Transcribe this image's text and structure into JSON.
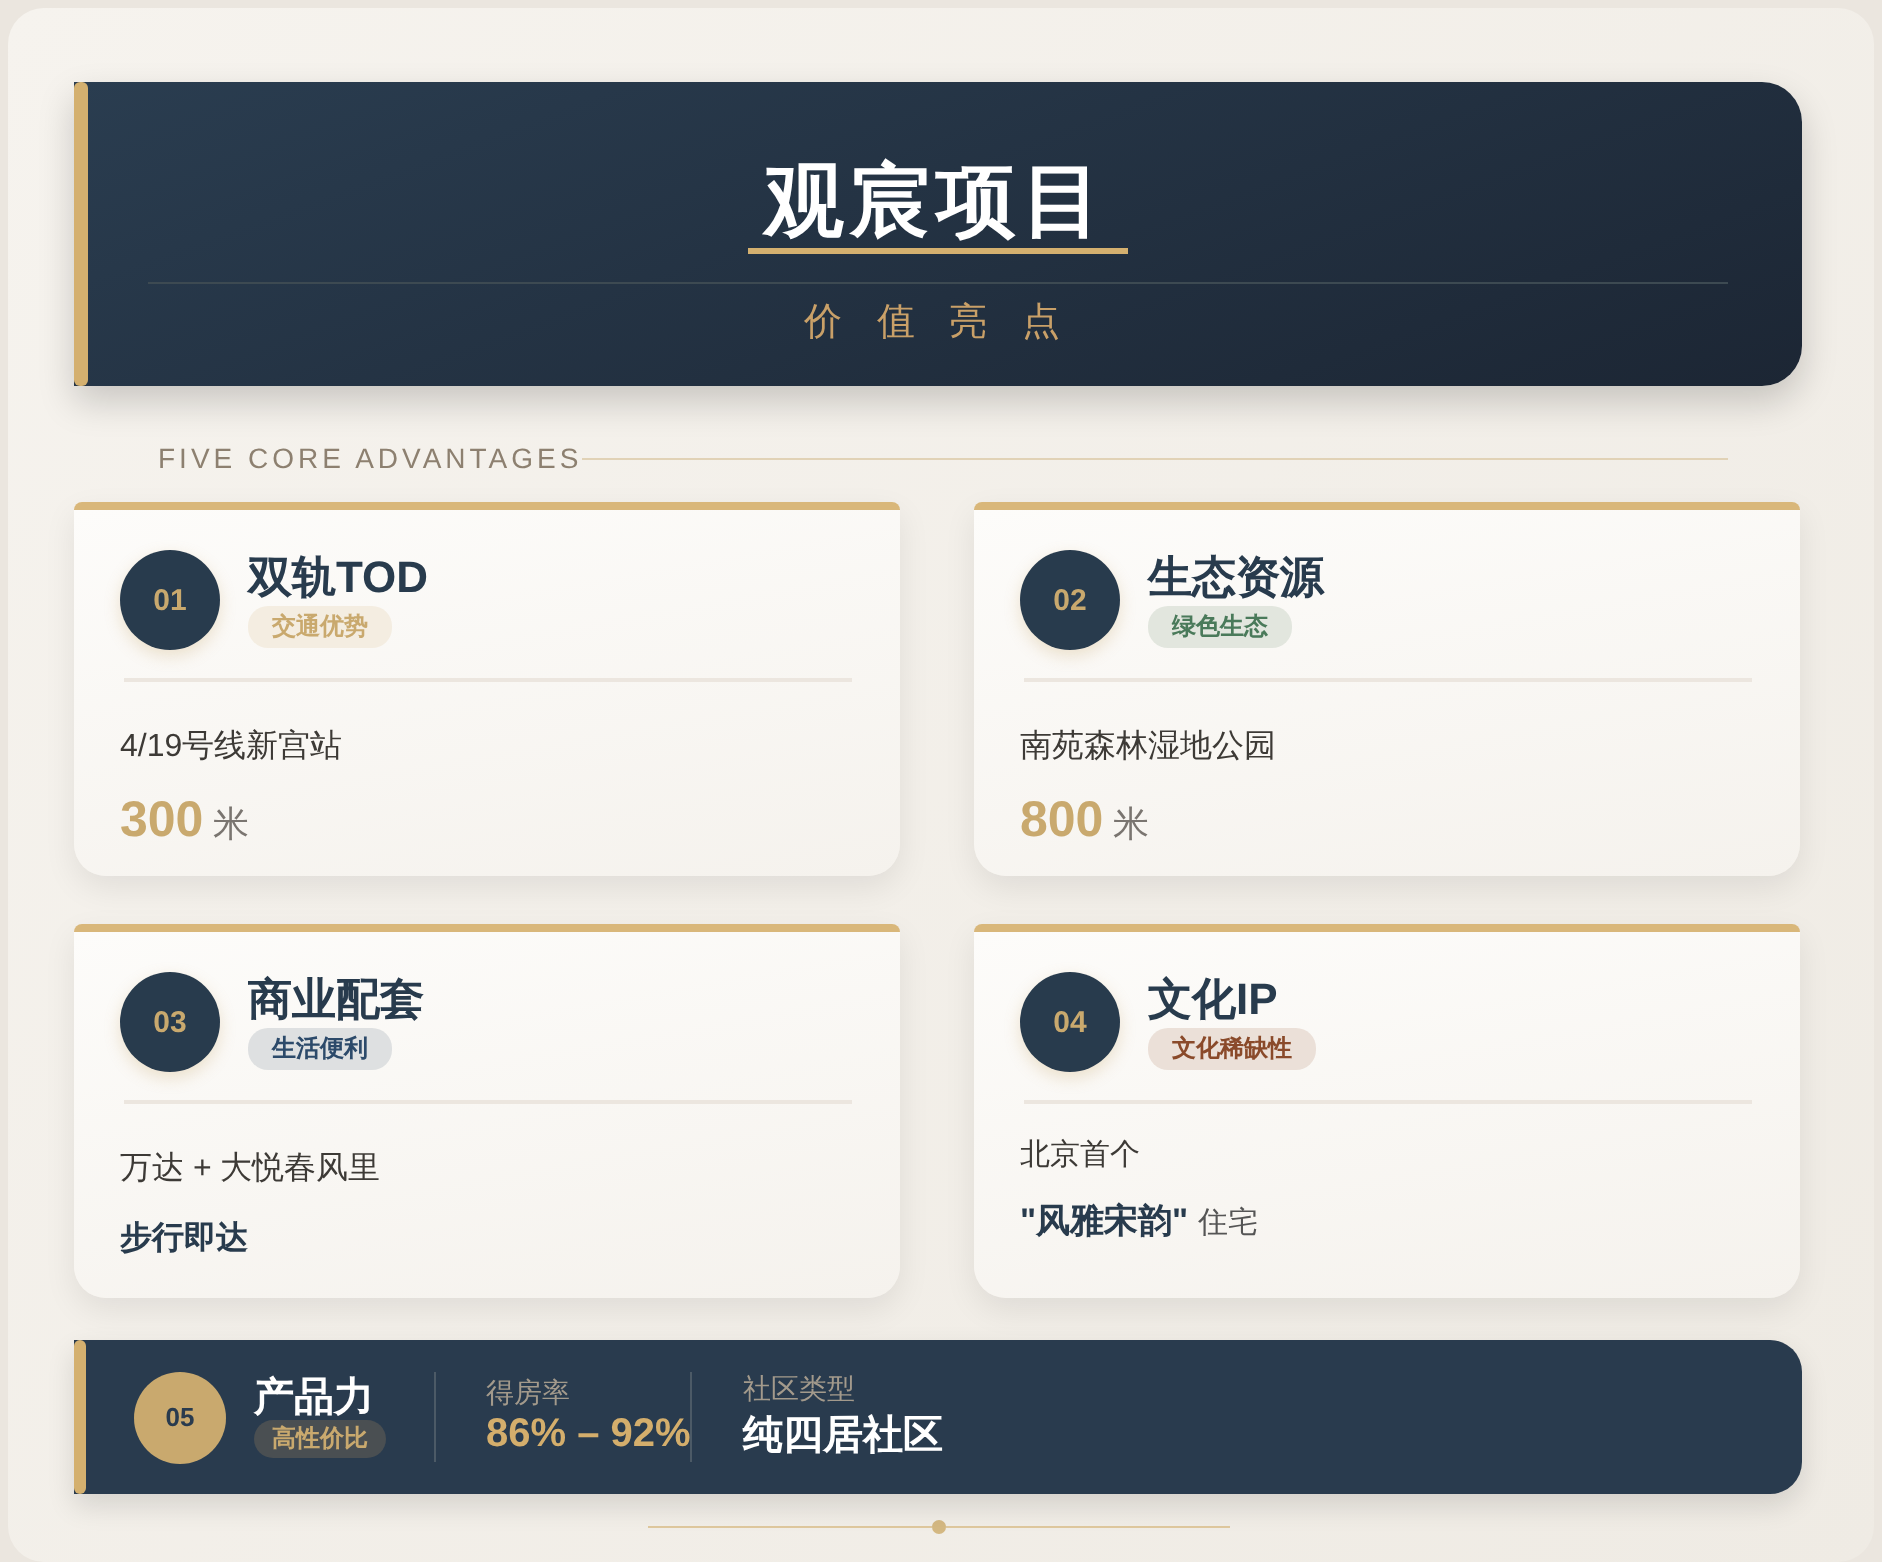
{
  "header": {
    "title": "观宸项目",
    "subtitle": "价 值 亮 点"
  },
  "section_label": "FIVE CORE ADVANTAGES",
  "cards": [
    {
      "number": "01",
      "title": "双轨TOD",
      "tag": {
        "label": "交通优势",
        "color": "#c9a96e"
      },
      "kind": "distance",
      "line": "4/19号线新宫站",
      "value": "300",
      "unit": "米"
    },
    {
      "number": "02",
      "title": "生态资源",
      "tag": {
        "label": "绿色生态",
        "color": "#4a7a5a"
      },
      "kind": "distance",
      "line": "南苑森林湿地公园",
      "value": "800",
      "unit": "米"
    },
    {
      "number": "03",
      "title": "商业配套",
      "tag": {
        "label": "生活便利",
        "color": "#2c4a6a"
      },
      "kind": "note",
      "line": "万达 + 大悦春风里",
      "note": "步行即达"
    },
    {
      "number": "04",
      "title": "文化IP",
      "tag": {
        "label": "文化稀缺性",
        "color": "#8a4a2a"
      },
      "kind": "quote",
      "line": "北京首个",
      "quote": "\"风雅宋韵\"",
      "suffix": "住宅"
    }
  ],
  "product": {
    "number": "05",
    "title": "产品力",
    "tag": "高性价比",
    "stats": [
      {
        "label": "得房率",
        "value": "86% – 92%",
        "kind": "gold"
      },
      {
        "label": "社区类型",
        "value": "纯四居社区",
        "kind": "white"
      }
    ]
  }
}
